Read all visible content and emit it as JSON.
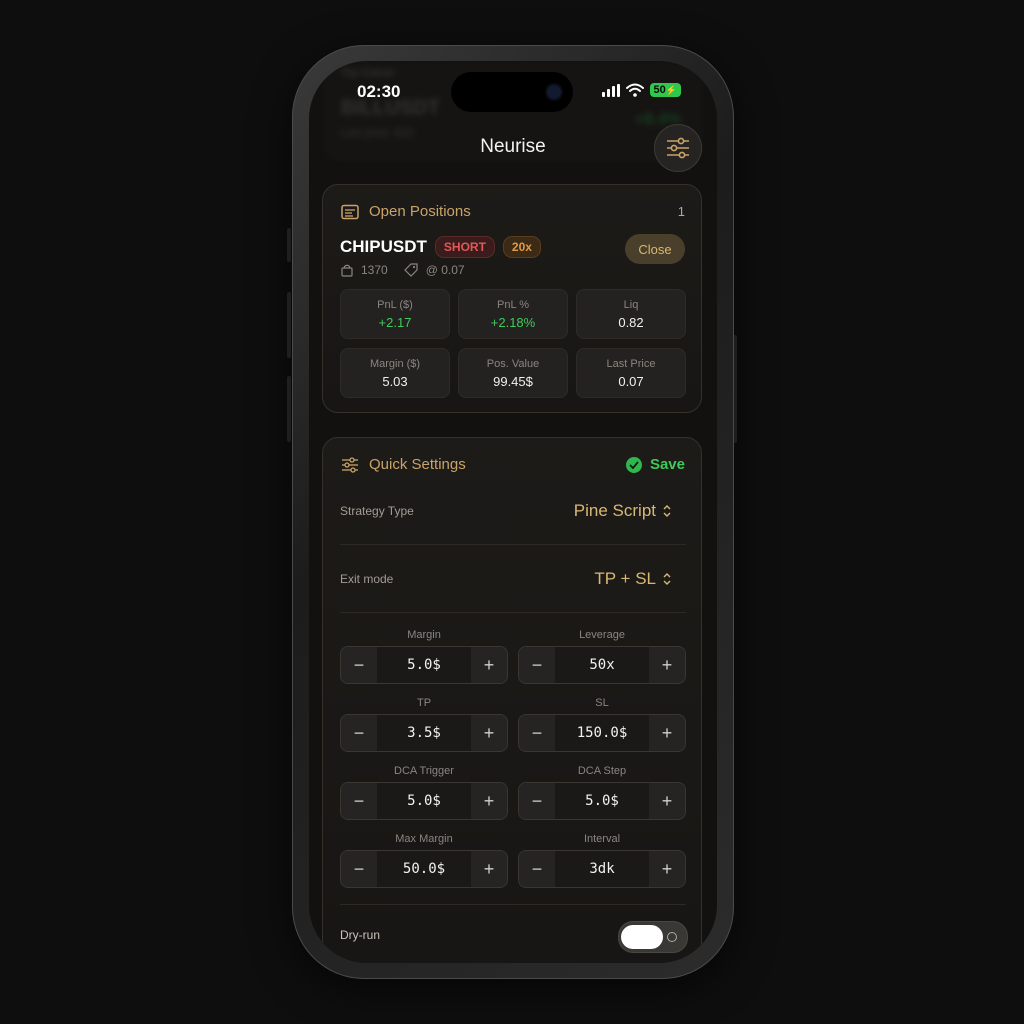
{
  "status_bar": {
    "time": "02:30",
    "battery": "50"
  },
  "ghost": {
    "label": "Top Gainer",
    "symbol": "BILLUSDT",
    "sub": "Last price: $16",
    "value": "+8.4%"
  },
  "header": {
    "title": "Neurise"
  },
  "open_positions": {
    "title": "Open Positions",
    "count": "1",
    "symbol": "CHIPUSDT",
    "side": "SHORT",
    "leverage": "20x",
    "close_label": "Close",
    "qty": "1370",
    "entry": "@ 0.07",
    "stats": [
      {
        "label": "PnL ($)",
        "value": "+2.17"
      },
      {
        "label": "PnL %",
        "value": "+2.18%"
      },
      {
        "label": "Liq",
        "value": "0.82"
      },
      {
        "label": "Margin ($)",
        "value": "5.03"
      },
      {
        "label": "Pos. Value",
        "value": "99.45$"
      },
      {
        "label": "Last Price",
        "value": "0.07"
      }
    ]
  },
  "quick_settings": {
    "title": "Quick Settings",
    "save_label": "Save",
    "strategy_type": {
      "label": "Strategy Type",
      "value": "Pine Script"
    },
    "exit_mode": {
      "label": "Exit mode",
      "value": "TP + SL"
    },
    "steppers": [
      {
        "label": "Margin",
        "value": "5.0$"
      },
      {
        "label": "Leverage",
        "value": "50x"
      },
      {
        "label": "TP",
        "value": "3.5$"
      },
      {
        "label": "SL",
        "value": "150.0$"
      },
      {
        "label": "DCA Trigger",
        "value": "5.0$"
      },
      {
        "label": "DCA Step",
        "value": "5.0$"
      },
      {
        "label": "Max Margin",
        "value": "50.0$"
      },
      {
        "label": "Interval",
        "value": "3dk"
      }
    ],
    "minus_glyph": "−",
    "plus_glyph": "+",
    "dry_run": {
      "label": "Dry-run",
      "enabled": true
    }
  },
  "colors": {
    "accent": "#c9a36a",
    "positive": "#3ec95b",
    "short": "#e05858",
    "leverage": "#e49a45"
  }
}
